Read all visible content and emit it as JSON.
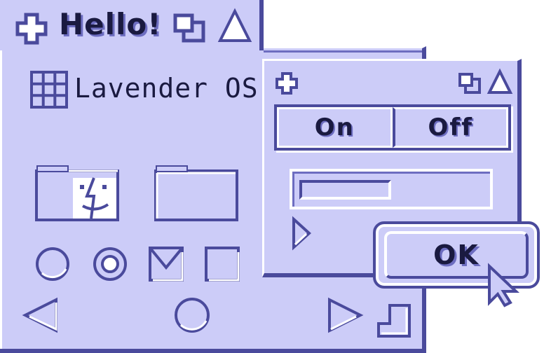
{
  "colors": {
    "face": "#ccccf8",
    "dark": "#4a4a9c",
    "mid": "#6d6dc0",
    "highlight": "#ffffff",
    "ink": "#1a1a40"
  },
  "main_window": {
    "title": "Hello!",
    "title_icons": [
      "cross-icon",
      "overlap-windows-icon",
      "triangle-icon"
    ],
    "os_icon": "grid-icon",
    "os_label": "Lavender OS",
    "folders": [
      "finder-folder-icon",
      "folder-icon"
    ],
    "controls": [
      {
        "type": "radio",
        "checked": false
      },
      {
        "type": "radio",
        "checked": true
      },
      {
        "type": "checkbox",
        "checked": true
      },
      {
        "type": "checkbox",
        "checked": false
      }
    ],
    "nav_icons": [
      "arrow-left-icon",
      "circle-icon",
      "arrow-right-icon",
      "resize-grip-icon"
    ]
  },
  "sub_window": {
    "title_icons": [
      "cross-icon",
      "overlap-windows-icon",
      "triangle-icon"
    ],
    "segmented": {
      "on_label": "On",
      "off_label": "Off"
    },
    "progress": {
      "value": 0.5
    },
    "play_icon": "play-arrow-icon"
  },
  "ok_button": {
    "label": "OK"
  },
  "cursor_icon": "pointer-cursor-icon"
}
